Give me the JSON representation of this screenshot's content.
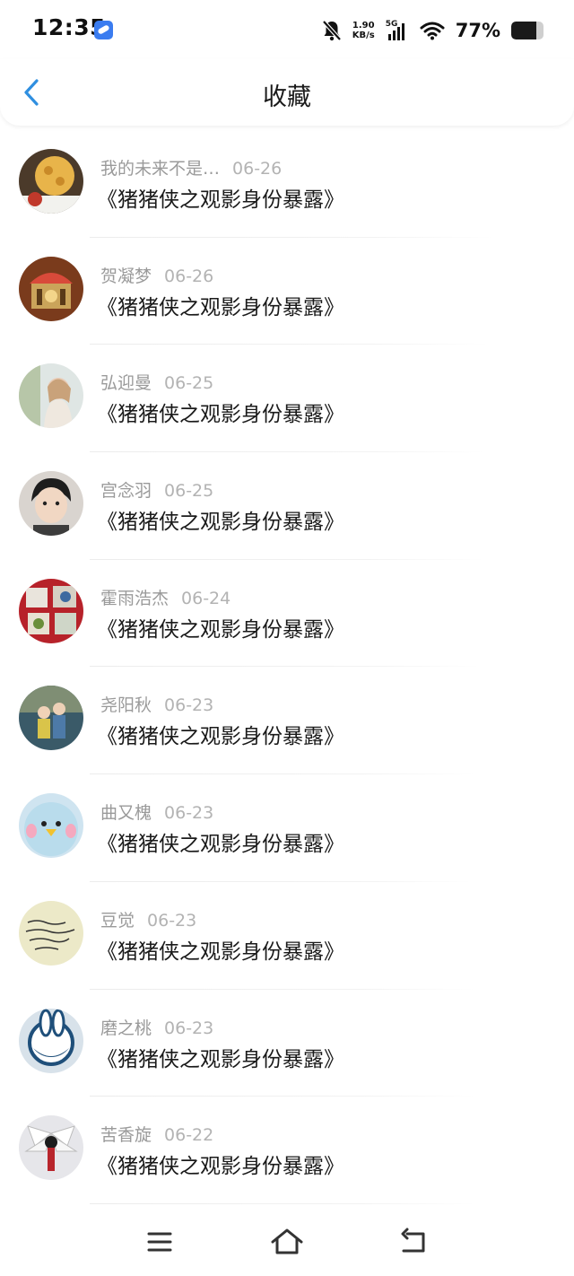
{
  "status_bar": {
    "time": "12:35",
    "net_speed_value": "1.90",
    "net_speed_unit": "KB/s",
    "network_type": "5G",
    "battery_percent": "77%",
    "battery_level": 0.77,
    "icons": [
      "app-notification-icon",
      "bell-muted-icon",
      "signal-icon",
      "wifi-icon",
      "battery-icon"
    ]
  },
  "header": {
    "title": "收藏",
    "back_icon": "chevron-left-icon",
    "accent_color": "#2f8fe0"
  },
  "favorites": [
    {
      "user": "我的未来不是…",
      "date": "06-26",
      "title": "《猪猪侠之观影身份暴露》"
    },
    {
      "user": "贺凝梦",
      "date": "06-26",
      "title": "《猪猪侠之观影身份暴露》"
    },
    {
      "user": "弘迎曼",
      "date": "06-25",
      "title": "《猪猪侠之观影身份暴露》"
    },
    {
      "user": "宫念羽",
      "date": "06-25",
      "title": "《猪猪侠之观影身份暴露》"
    },
    {
      "user": "霍雨浩杰",
      "date": "06-24",
      "title": "《猪猪侠之观影身份暴露》"
    },
    {
      "user": "尧阳秋",
      "date": "06-23",
      "title": "《猪猪侠之观影身份暴露》"
    },
    {
      "user": "曲又槐",
      "date": "06-23",
      "title": "《猪猪侠之观影身份暴露》"
    },
    {
      "user": "豆觉",
      "date": "06-23",
      "title": "《猪猪侠之观影身份暴露》"
    },
    {
      "user": "磨之桃",
      "date": "06-23",
      "title": "《猪猪侠之观影身份暴露》"
    },
    {
      "user": "苦香旋",
      "date": "06-22",
      "title": "《猪猪侠之观影身份暴露》"
    }
  ],
  "nav_bar": {
    "icons": [
      "menu-icon",
      "home-icon",
      "back-icon"
    ]
  }
}
